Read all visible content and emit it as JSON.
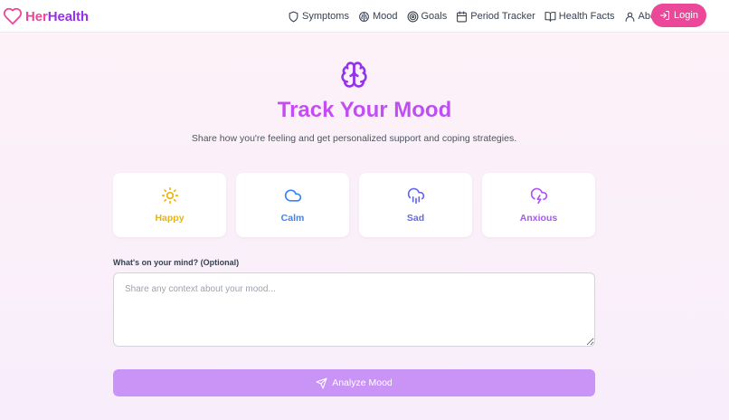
{
  "brand": {
    "part1": "Her",
    "part2": "Health"
  },
  "nav": {
    "items": [
      {
        "label": "Symptoms",
        "icon": "shield-icon"
      },
      {
        "label": "Mood",
        "icon": "brain-icon"
      },
      {
        "label": "Goals",
        "icon": "target-icon"
      },
      {
        "label": "Period Tracker",
        "icon": "calendar-icon"
      },
      {
        "label": "Health Facts",
        "icon": "book-open-icon"
      },
      {
        "label": "About",
        "icon": "user-icon"
      }
    ],
    "login_label": "Login"
  },
  "hero": {
    "title": "Track Your Mood",
    "subtitle": "Share how you're feeling and get personalized support and coping strategies."
  },
  "moods": [
    {
      "label": "Happy",
      "icon": "sun-icon",
      "color": "#eab308"
    },
    {
      "label": "Calm",
      "icon": "cloud-icon",
      "color": "#3b82f6"
    },
    {
      "label": "Sad",
      "icon": "cloud-rain-icon",
      "color": "#6366f1"
    },
    {
      "label": "Anxious",
      "icon": "cloud-lightning-icon",
      "color": "#a855f7"
    }
  ],
  "context": {
    "label": "What's on your mind? (Optional)",
    "placeholder": "Share any context about your mood...",
    "value": ""
  },
  "analyze": {
    "label": "Analyze Mood"
  },
  "colors": {
    "brand_pink": "#ec4899",
    "brand_purple": "#9333ea",
    "button_disabled": "#c994f5"
  }
}
